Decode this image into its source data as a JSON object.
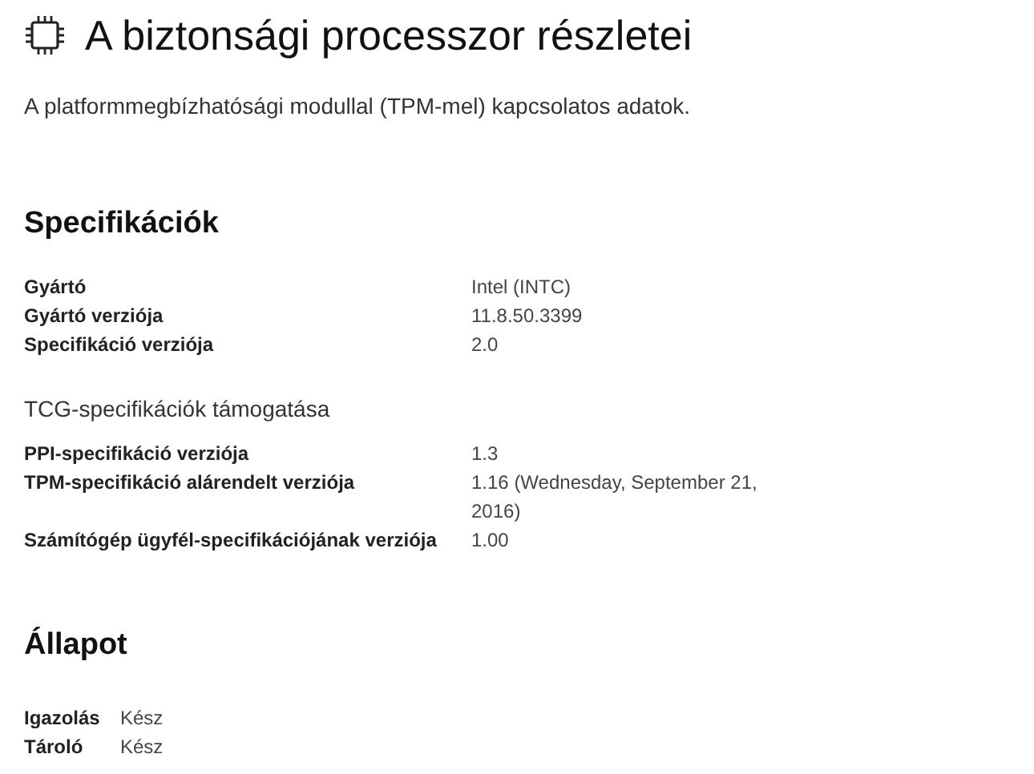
{
  "title": "A biztonsági processzor részletei",
  "subtitle": "A platformmegbízhatósági modullal (TPM-mel) kapcsolatos adatok.",
  "specifications": {
    "heading": "Specifikációk",
    "rows": [
      {
        "label": "Gyártó",
        "value": "Intel (INTC)"
      },
      {
        "label": "Gyártó verziója",
        "value": "11.8.50.3399"
      },
      {
        "label": "Specifikáció verziója",
        "value": "2.0"
      }
    ],
    "tcg": {
      "heading": "TCG-specifikációk támogatása",
      "rows": [
        {
          "label": "PPI-specifikáció verziója",
          "value": "1.3"
        },
        {
          "label": "TPM-specifikáció alárendelt verziója",
          "value": "1.16 (Wednesday, September 21, 2016)"
        },
        {
          "label": "Számítógép ügyfél-specifikációjának verziója",
          "value": "1.00"
        }
      ]
    }
  },
  "status": {
    "heading": "Állapot",
    "rows": [
      {
        "label": "Igazolás",
        "value": "Kész"
      },
      {
        "label": "Tároló",
        "value": "Kész"
      }
    ]
  }
}
